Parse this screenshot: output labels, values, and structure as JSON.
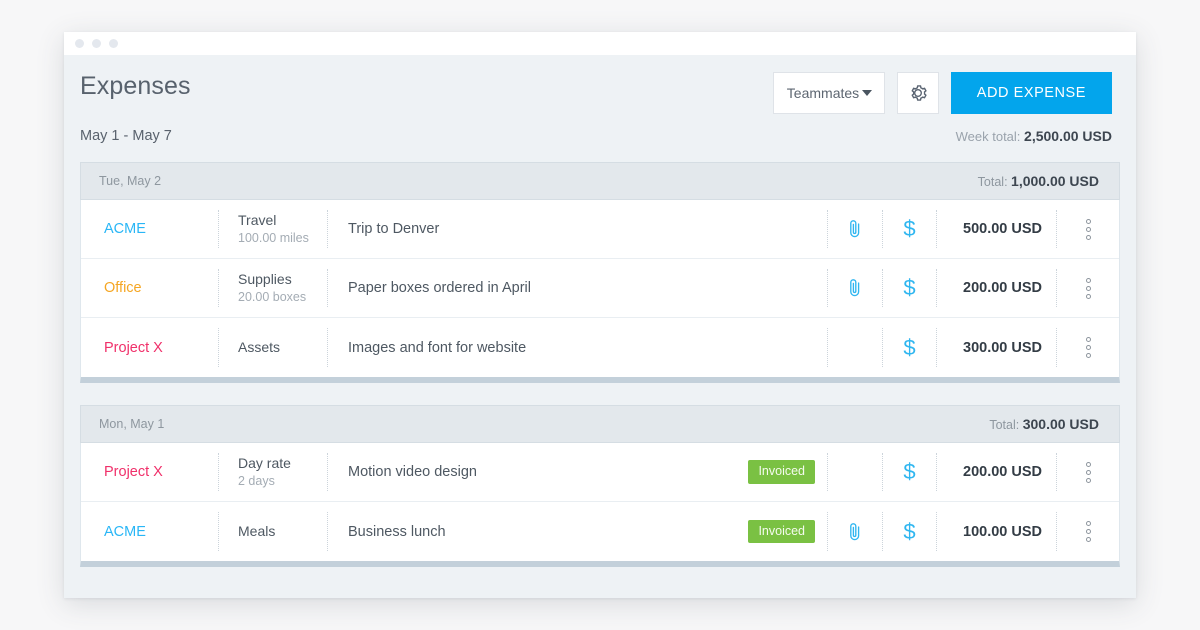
{
  "window": {
    "dots": 3
  },
  "header": {
    "title": "Expenses",
    "teammates_label": "Teammates",
    "gear_icon": "gear-icon",
    "add_expense_label": "ADD EXPENSE"
  },
  "subheader": {
    "date_range": "May 1 - May 7",
    "week_total_label": "Week total:",
    "week_total_value": "2,500.00 USD"
  },
  "colors": {
    "accent": "#03a5ec",
    "client_acme": "#29b6f6",
    "client_office": "#f5a623",
    "client_projectx": "#f0306a",
    "badge_green": "#7ac143",
    "icon_blue": "#2fb6f0"
  },
  "groups": [
    {
      "date": "Tue, May 2",
      "total_label": "Total:",
      "total_value": "1,000.00 USD",
      "rows": [
        {
          "client": "ACME",
          "client_color": "#29b6f6",
          "type": "Travel",
          "quantity": "100.00 miles",
          "description": "Trip to Denver",
          "badge": "",
          "has_attachment": true,
          "has_billable": true,
          "amount": "500.00 USD"
        },
        {
          "client": "Office",
          "client_color": "#f5a623",
          "type": "Supplies",
          "quantity": "20.00 boxes",
          "description": "Paper boxes ordered in April",
          "badge": "",
          "has_attachment": true,
          "has_billable": true,
          "amount": "200.00 USD"
        },
        {
          "client": "Project X",
          "client_color": "#f0306a",
          "type": "Assets",
          "quantity": "",
          "description": "Images and font for website",
          "badge": "",
          "has_attachment": false,
          "has_billable": true,
          "amount": "300.00 USD"
        }
      ]
    },
    {
      "date": "Mon, May 1",
      "total_label": "Total:",
      "total_value": "300.00 USD",
      "rows": [
        {
          "client": "Project X",
          "client_color": "#f0306a",
          "type": "Day rate",
          "quantity": "2 days",
          "description": "Motion video design",
          "badge": "Invoiced",
          "has_attachment": false,
          "has_billable": true,
          "amount": "200.00 USD"
        },
        {
          "client": "ACME",
          "client_color": "#29b6f6",
          "type": "Meals",
          "quantity": "",
          "description": "Business lunch",
          "badge": "Invoiced",
          "has_attachment": true,
          "has_billable": true,
          "amount": "100.00 USD"
        }
      ]
    }
  ]
}
